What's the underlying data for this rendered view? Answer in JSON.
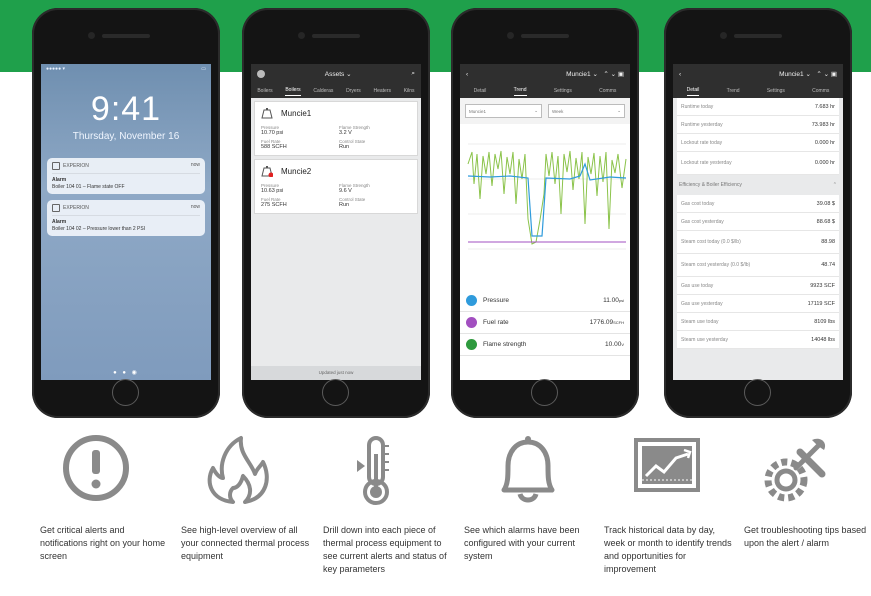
{
  "colors": {
    "brand_green": "#1fa04b",
    "pressure": "#2f9bdc",
    "fuel_rate": "#a24fc0",
    "flame_strength": "#2e9a3e"
  },
  "lockscreen": {
    "time": "9:41",
    "date": "Thursday, November 16",
    "notifications": [
      {
        "app": "EXPERION",
        "when": "now",
        "title": "Alarm",
        "body": "Boiler 104 01 – Flame state OFF"
      },
      {
        "app": "EXPERION",
        "when": "now",
        "title": "Alarm",
        "body": "Boiler 104 02 – Pressure lower than 2 PSI"
      }
    ]
  },
  "assets_screen": {
    "title": "Assets",
    "tabs": [
      "Boilers",
      "Boilers",
      "Calderas",
      "Dryers",
      "Heaters",
      "Kilns"
    ],
    "cards": [
      {
        "name": "Muncie1",
        "fields": [
          {
            "label": "Pressure",
            "value": "10.70 psi"
          },
          {
            "label": "Flame Strength",
            "value": "3.2 V"
          },
          {
            "label": "Fuel Rate",
            "value": "588 SCFH"
          },
          {
            "label": "Control State",
            "value": "Run"
          }
        ]
      },
      {
        "name": "Muncie2",
        "fields": [
          {
            "label": "Pressure",
            "value": "10.63 psi"
          },
          {
            "label": "Flame Strength",
            "value": "9.6 V"
          },
          {
            "label": "Fuel Rate",
            "value": "275 SCFH"
          },
          {
            "label": "Control State",
            "value": "Run"
          }
        ]
      }
    ],
    "footer": "Updated just now"
  },
  "trend_screen": {
    "title": "Muncie1",
    "tabs": [
      "Detail",
      "Trend",
      "Settings",
      "Comms"
    ],
    "selects": [
      "Muncie1",
      "Week"
    ],
    "legend": [
      {
        "name": "Pressure",
        "value": "11.00",
        "unit": "psi"
      },
      {
        "name": "Fuel rate",
        "value": "1776.09",
        "unit": "SCFH"
      },
      {
        "name": "Flame strength",
        "value": "10.00",
        "unit": "V"
      }
    ]
  },
  "detail_screen": {
    "title": "Muncie1",
    "tabs": [
      "Detail",
      "Trend",
      "Settings",
      "Comms"
    ],
    "rows_top": [
      {
        "label": "Runtime today",
        "value": "7.683 hr"
      },
      {
        "label": "Runtime yesterday",
        "value": "73.983 hr"
      },
      {
        "label": "Lockout rate today",
        "value": "0.000 hr"
      },
      {
        "label": "Lockout rate yesterday",
        "value": "0.000 hr"
      }
    ],
    "section": "Efficiency & Boiler Efficiency",
    "rows_bottom": [
      {
        "label": "Gas cost today",
        "value": "39.08 $"
      },
      {
        "label": "Gas cost yesterday",
        "value": "88.68 $"
      },
      {
        "label": "Steam cost today (0.0 $/lb)",
        "value": "88.98"
      },
      {
        "label": "Steam cost yesterday (0.0 $/lb)",
        "value": "48.74"
      },
      {
        "label": "Gas use today",
        "value": "9923 SCF"
      },
      {
        "label": "Gas use yesterday",
        "value": "17119 SCF"
      },
      {
        "label": "Steam use today",
        "value": "8109 lbs"
      },
      {
        "label": "Steam use yesterday",
        "value": "14048 lbs"
      }
    ]
  },
  "features": [
    {
      "icon": "alert-icon",
      "text": "Get critical alerts and notifications right on your home screen"
    },
    {
      "icon": "flame-icon",
      "text": "See high-level overview of all your connected thermal process equipment"
    },
    {
      "icon": "thermometer-icon",
      "text": "Drill down into each piece of thermal process equipment  to see current alerts and status of key parameters"
    },
    {
      "icon": "bell-icon",
      "text": "See which alarms have been configured with your current system"
    },
    {
      "icon": "trend-chart-icon",
      "text": "Track historical data by day, week or month to identify trends and opportunities for improvement"
    },
    {
      "icon": "troubleshooting-tools-icon",
      "text": "Get troubleshooting tips based upon the alert / alarm"
    }
  ]
}
